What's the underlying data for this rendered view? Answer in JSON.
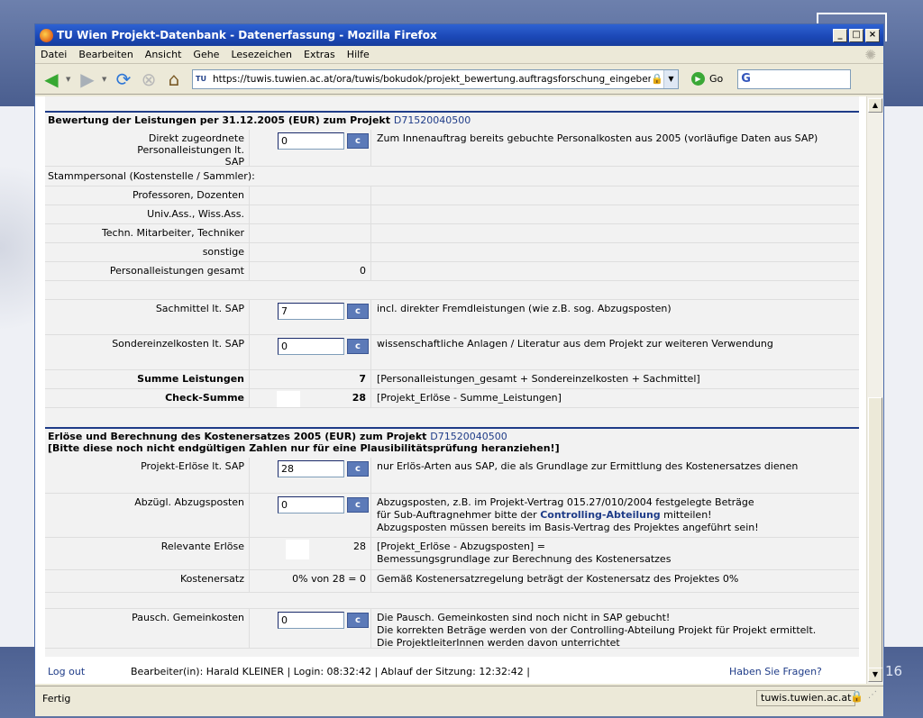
{
  "slide": {
    "page_number": "16"
  },
  "window": {
    "title": "TU Wien Projekt-Datenbank - Datenerfassung - Mozilla Firefox",
    "minimize": "_",
    "maximize": "□",
    "close": "×"
  },
  "menu": [
    "Datei",
    "Bearbeiten",
    "Ansicht",
    "Gehe",
    "Lesezeichen",
    "Extras",
    "Hilfe"
  ],
  "nav": {
    "url": "https://tuwis.tuwien.ac.at/ora/tuwis/bokudok/projekt_bewertung.auftragsforschung_eingeben?sid",
    "favicon": "TU",
    "go_label": "Go",
    "search_placeholder": "G"
  },
  "section1": {
    "title": "Bewertung der Leistungen per 31.12.2005 (EUR)  zum Projekt",
    "project_link": "D71520040500",
    "rows": [
      {
        "label": "Direkt zugeordnete Personalleistungen lt. SAP",
        "input": "0",
        "btn": "c",
        "desc": "Zum Innenauftrag bereits gebuchte Personalkosten aus 2005 (vorläufige Daten aus SAP)"
      },
      {
        "label_left": "Stammpersonal (Kostenstelle / Sammler):"
      },
      {
        "label": "Professoren, Dozenten"
      },
      {
        "label": "Univ.Ass., Wiss.Ass."
      },
      {
        "label": "Techn. Mitarbeiter, Techniker"
      },
      {
        "label": "sonstige"
      },
      {
        "label": "Personalleistungen gesamt",
        "value": "0"
      },
      {
        "label": "Sachmittel lt. SAP",
        "input": "7",
        "btn": "c",
        "desc": "incl. direkter Fremdleistungen (wie z.B. sog. Abzugsposten)"
      },
      {
        "label": "Sondereinzelkosten lt. SAP",
        "input": "0",
        "btn": "c",
        "desc": "wissenschaftliche Anlagen / Literatur aus dem Projekt zur weiteren Verwendung"
      },
      {
        "label": "Summe Leistungen",
        "value": "7",
        "desc": "[Personalleistungen_gesamt + Sondereinzelkosten + Sachmittel]"
      },
      {
        "label": "Check-Summe",
        "value": "28",
        "desc": "[Projekt_Erlöse - Summe_Leistungen]"
      }
    ]
  },
  "section2": {
    "title": "Erlöse und Berechnung des Kostenersatzes 2005 (EUR)  zum Projekt",
    "project_link": "D71520040500",
    "subtitle": "[Bitte diese noch nicht endgültigen Zahlen nur für eine Plausibilitätsprüfung heranziehen!]",
    "rows": [
      {
        "label": "Projekt-Erlöse lt. SAP",
        "input": "28",
        "btn": "c",
        "desc": "nur Erlös-Arten aus SAP, die als Grundlage zur Ermittlung des Kostenersatzes dienen"
      },
      {
        "label": "Abzügl. Abzugsposten",
        "input": "0",
        "btn": "c",
        "desc1": "Abzugsposten, z.B. im Projekt-Vertrag 015.27/010/2004 festgelegte Beträge",
        "desc2a": "für Sub-Auftragnehmer bitte der ",
        "desc2b": "Controlling-Abteilung",
        "desc2c": " mitteilen!",
        "desc3": "Abzugsposten müssen bereits im Basis-Vertrag des Projektes angeführt sein!"
      },
      {
        "label": "Relevante Erlöse",
        "value": "28",
        "desc1": "[Projekt_Erlöse - Abzugsposten] =",
        "desc2": "Bemessungsgrundlage zur Berechnung des Kostenersatzes"
      },
      {
        "label": "Kostenersatz",
        "value": "0% von 28 = 0",
        "desc": "Gemäß Kostenersatzregelung beträgt der Kostenersatz des Projektes 0%"
      },
      {
        "label": "Pausch. Gemeinkosten",
        "input": "0",
        "btn": "c",
        "desc1": "Die Pausch. Gemeinkosten sind noch nicht in SAP gebucht!",
        "desc2": "Die korrekten Beträge werden von der Controlling-Abteilung Projekt für Projekt ermittelt.",
        "desc3": "Die ProjektleiterInnen werden davon unterrichtet"
      }
    ]
  },
  "footer": {
    "logout": "Log out",
    "user_info": "Bearbeiter(in): Harald KLEINER | Login: 08:32:42 | Ablauf der Sitzung: 12:32:42 |",
    "help": "Haben Sie Fragen?"
  },
  "status": {
    "text": "Fertig",
    "host": "tuwis.tuwien.ac.at"
  }
}
